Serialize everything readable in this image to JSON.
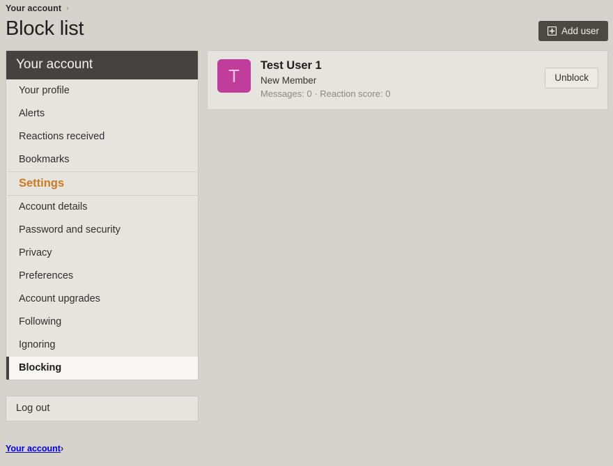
{
  "breadcrumb_top": {
    "label": "Your account",
    "chevron": "›"
  },
  "header": {
    "title": "Block list",
    "add_user_label": "Add user",
    "add_user_icon": "plus-square-icon"
  },
  "sidebar": {
    "header": "Your account",
    "items": [
      {
        "label": "Your profile",
        "state": "normal"
      },
      {
        "label": "Alerts",
        "state": "normal"
      },
      {
        "label": "Reactions received",
        "state": "normal"
      },
      {
        "label": "Bookmarks",
        "state": "normal"
      },
      {
        "label": "Settings",
        "state": "section"
      },
      {
        "label": "Account details",
        "state": "normal"
      },
      {
        "label": "Password and security",
        "state": "normal"
      },
      {
        "label": "Privacy",
        "state": "normal"
      },
      {
        "label": "Preferences",
        "state": "normal"
      },
      {
        "label": "Account upgrades",
        "state": "normal"
      },
      {
        "label": "Following",
        "state": "normal"
      },
      {
        "label": "Ignoring",
        "state": "normal"
      },
      {
        "label": "Blocking",
        "state": "active"
      }
    ],
    "logout_label": "Log out"
  },
  "main": {
    "blocked_users": [
      {
        "avatar_letter": "T",
        "avatar_color": "#c13d9c",
        "name": "Test User 1",
        "user_title": "New Member",
        "stats": "Messages: 0 · Reaction score: 0",
        "action_label": "Unblock"
      }
    ]
  },
  "breadcrumb_bottom": {
    "label": "Your account",
    "chevron": "›"
  },
  "colors": {
    "page_background": "#d5d3cc",
    "panel_background": "#e6e4de",
    "sidebar_header": "#454240",
    "section_accent": "#cc7a1e",
    "active_background": "#f7f6f2",
    "muted_text": "#8b8880"
  }
}
